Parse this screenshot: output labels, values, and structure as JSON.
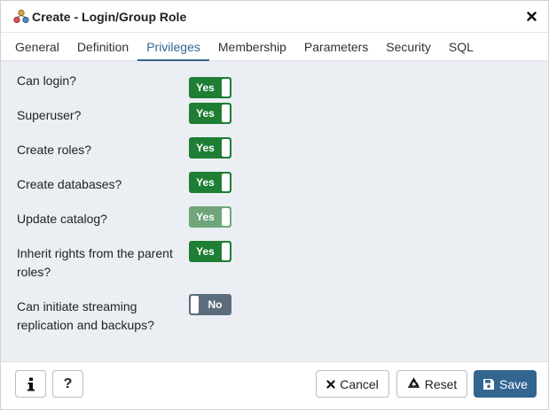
{
  "dialog": {
    "title": "Create - Login/Group Role",
    "icons": {
      "title": "role-group-icon",
      "close": "close-icon"
    }
  },
  "tabs": [
    {
      "label": "General",
      "active": false
    },
    {
      "label": "Definition",
      "active": false
    },
    {
      "label": "Privileges",
      "active": true
    },
    {
      "label": "Membership",
      "active": false
    },
    {
      "label": "Parameters",
      "active": false
    },
    {
      "label": "Security",
      "active": false
    },
    {
      "label": "SQL",
      "active": false
    }
  ],
  "privileges": [
    {
      "label": "Can login?",
      "value": "Yes",
      "state": "on"
    },
    {
      "label": "Superuser?",
      "value": "Yes",
      "state": "on"
    },
    {
      "label": "Create roles?",
      "value": "Yes",
      "state": "on"
    },
    {
      "label": "Create databases?",
      "value": "Yes",
      "state": "on"
    },
    {
      "label": "Update catalog?",
      "value": "Yes",
      "state": "on-disabled"
    },
    {
      "label": "Inherit rights from the parent roles?",
      "value": "Yes",
      "state": "on"
    },
    {
      "label": "Can initiate streaming replication and backups?",
      "value": "No",
      "state": "off"
    }
  ],
  "footer": {
    "info_icon": "info-icon",
    "help_label": "?",
    "cancel_label": "Cancel",
    "reset_label": "Reset",
    "save_label": "Save"
  },
  "colors": {
    "accent": "#326690",
    "toggle_on": "#1e7e34",
    "toggle_on_disabled": "#6fa57a",
    "toggle_off": "#5b6d7c",
    "body_bg": "#ebeef3"
  }
}
